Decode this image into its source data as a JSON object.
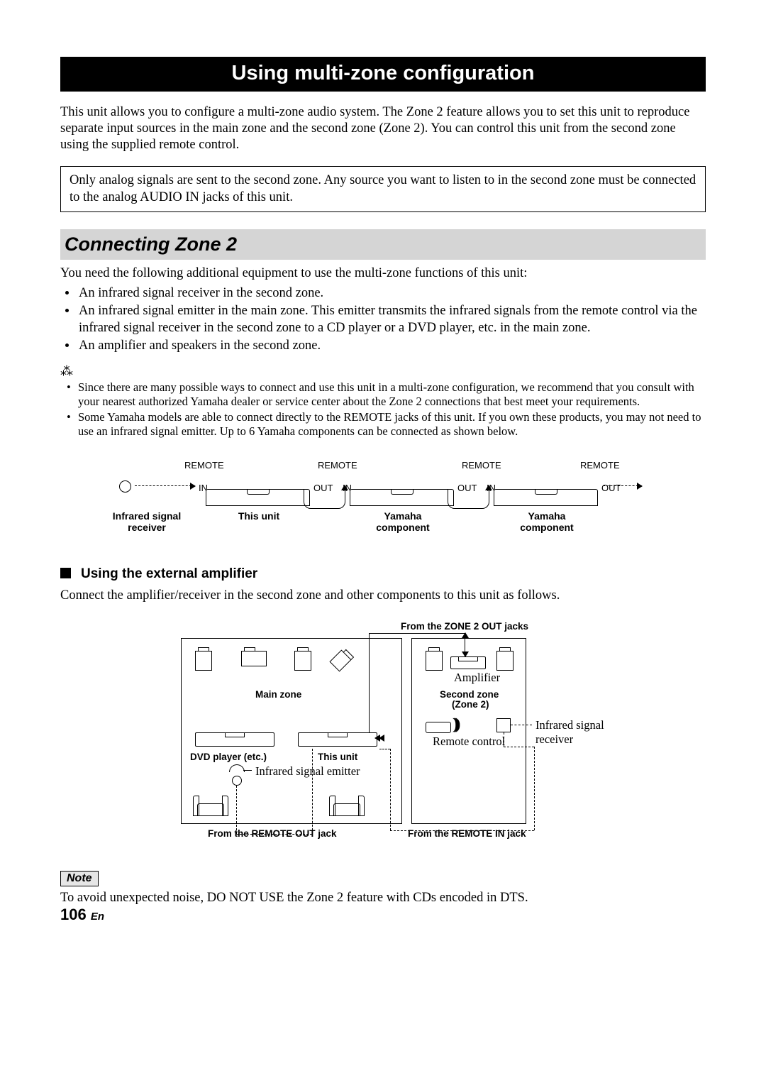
{
  "title": "Using multi-zone configuration",
  "intro": "This unit allows you to configure a multi-zone audio system. The Zone 2 feature allows you to set this unit to reproduce separate input sources in the main zone and the second zone (Zone 2). You can control this unit from the second zone using the supplied remote control.",
  "analog_note": "Only analog signals are sent to the second zone. Any source you want to listen to in the second zone must be connected to the analog AUDIO IN jacks of this unit.",
  "section_heading": "Connecting Zone 2",
  "equip_intro": "You need the following additional equipment to use the multi-zone functions of this unit:",
  "equip": [
    "An infrared signal receiver in the second zone.",
    "An infrared signal emitter in the main zone. This emitter transmits the infrared signals from the remote control via the infrared signal receiver in the second zone to a CD player or a DVD player, etc. in the main zone.",
    "An amplifier and speakers in the second zone."
  ],
  "hints": [
    "Since there are many possible ways to connect and use this unit in a multi-zone configuration, we recommend that you consult with your nearest authorized Yamaha dealer or service center about the Zone 2 connections that best meet your requirements.",
    "Some Yamaha models are able to connect directly to the REMOTE jacks of this unit. If you own these products, you may not need to use an infrared signal emitter. Up to 6 Yamaha components can be connected as shown below."
  ],
  "d1": {
    "remote": "REMOTE",
    "in": "IN",
    "out": "OUT",
    "labels": [
      "Infrared signal\nreceiver",
      "This unit",
      "Yamaha\ncomponent",
      "Yamaha\ncomponent"
    ]
  },
  "sub_heading": "Using the external amplifier",
  "sub_p": "Connect the amplifier/receiver in the second zone and other components to this unit as follows.",
  "d2": {
    "from_zone2": "From the ZONE 2 OUT jacks",
    "amplifier": "Amplifier",
    "main_zone": "Main zone",
    "second_zone1": "Second zone",
    "second_zone2": "(Zone 2)",
    "ir_recv": "Infrared signal receiver",
    "remote_ctrl": "Remote control",
    "dvd": "DVD player (etc.)",
    "this_unit": "This unit",
    "ir_emit": "Infrared signal emitter",
    "from_rout": "From the REMOTE OUT jack",
    "from_rin": "From the REMOTE IN jack"
  },
  "note_label": "Note",
  "note_text": "To avoid unexpected noise, DO NOT USE the Zone 2 feature with CDs encoded in DTS.",
  "page_num": "106",
  "page_lang": "En"
}
